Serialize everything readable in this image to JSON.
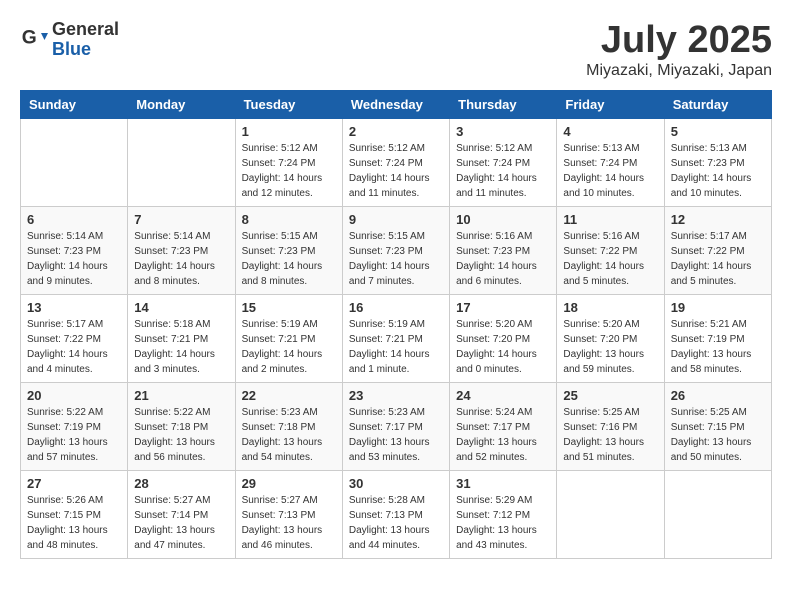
{
  "logo": {
    "general": "General",
    "blue": "Blue"
  },
  "header": {
    "month": "July 2025",
    "location": "Miyazaki, Miyazaki, Japan"
  },
  "weekdays": [
    "Sunday",
    "Monday",
    "Tuesday",
    "Wednesday",
    "Thursday",
    "Friday",
    "Saturday"
  ],
  "weeks": [
    [
      {
        "day": "",
        "info": ""
      },
      {
        "day": "",
        "info": ""
      },
      {
        "day": "1",
        "info": "Sunrise: 5:12 AM\nSunset: 7:24 PM\nDaylight: 14 hours and 12 minutes."
      },
      {
        "day": "2",
        "info": "Sunrise: 5:12 AM\nSunset: 7:24 PM\nDaylight: 14 hours and 11 minutes."
      },
      {
        "day": "3",
        "info": "Sunrise: 5:12 AM\nSunset: 7:24 PM\nDaylight: 14 hours and 11 minutes."
      },
      {
        "day": "4",
        "info": "Sunrise: 5:13 AM\nSunset: 7:24 PM\nDaylight: 14 hours and 10 minutes."
      },
      {
        "day": "5",
        "info": "Sunrise: 5:13 AM\nSunset: 7:23 PM\nDaylight: 14 hours and 10 minutes."
      }
    ],
    [
      {
        "day": "6",
        "info": "Sunrise: 5:14 AM\nSunset: 7:23 PM\nDaylight: 14 hours and 9 minutes."
      },
      {
        "day": "7",
        "info": "Sunrise: 5:14 AM\nSunset: 7:23 PM\nDaylight: 14 hours and 8 minutes."
      },
      {
        "day": "8",
        "info": "Sunrise: 5:15 AM\nSunset: 7:23 PM\nDaylight: 14 hours and 8 minutes."
      },
      {
        "day": "9",
        "info": "Sunrise: 5:15 AM\nSunset: 7:23 PM\nDaylight: 14 hours and 7 minutes."
      },
      {
        "day": "10",
        "info": "Sunrise: 5:16 AM\nSunset: 7:23 PM\nDaylight: 14 hours and 6 minutes."
      },
      {
        "day": "11",
        "info": "Sunrise: 5:16 AM\nSunset: 7:22 PM\nDaylight: 14 hours and 5 minutes."
      },
      {
        "day": "12",
        "info": "Sunrise: 5:17 AM\nSunset: 7:22 PM\nDaylight: 14 hours and 5 minutes."
      }
    ],
    [
      {
        "day": "13",
        "info": "Sunrise: 5:17 AM\nSunset: 7:22 PM\nDaylight: 14 hours and 4 minutes."
      },
      {
        "day": "14",
        "info": "Sunrise: 5:18 AM\nSunset: 7:21 PM\nDaylight: 14 hours and 3 minutes."
      },
      {
        "day": "15",
        "info": "Sunrise: 5:19 AM\nSunset: 7:21 PM\nDaylight: 14 hours and 2 minutes."
      },
      {
        "day": "16",
        "info": "Sunrise: 5:19 AM\nSunset: 7:21 PM\nDaylight: 14 hours and 1 minute."
      },
      {
        "day": "17",
        "info": "Sunrise: 5:20 AM\nSunset: 7:20 PM\nDaylight: 14 hours and 0 minutes."
      },
      {
        "day": "18",
        "info": "Sunrise: 5:20 AM\nSunset: 7:20 PM\nDaylight: 13 hours and 59 minutes."
      },
      {
        "day": "19",
        "info": "Sunrise: 5:21 AM\nSunset: 7:19 PM\nDaylight: 13 hours and 58 minutes."
      }
    ],
    [
      {
        "day": "20",
        "info": "Sunrise: 5:22 AM\nSunset: 7:19 PM\nDaylight: 13 hours and 57 minutes."
      },
      {
        "day": "21",
        "info": "Sunrise: 5:22 AM\nSunset: 7:18 PM\nDaylight: 13 hours and 56 minutes."
      },
      {
        "day": "22",
        "info": "Sunrise: 5:23 AM\nSunset: 7:18 PM\nDaylight: 13 hours and 54 minutes."
      },
      {
        "day": "23",
        "info": "Sunrise: 5:23 AM\nSunset: 7:17 PM\nDaylight: 13 hours and 53 minutes."
      },
      {
        "day": "24",
        "info": "Sunrise: 5:24 AM\nSunset: 7:17 PM\nDaylight: 13 hours and 52 minutes."
      },
      {
        "day": "25",
        "info": "Sunrise: 5:25 AM\nSunset: 7:16 PM\nDaylight: 13 hours and 51 minutes."
      },
      {
        "day": "26",
        "info": "Sunrise: 5:25 AM\nSunset: 7:15 PM\nDaylight: 13 hours and 50 minutes."
      }
    ],
    [
      {
        "day": "27",
        "info": "Sunrise: 5:26 AM\nSunset: 7:15 PM\nDaylight: 13 hours and 48 minutes."
      },
      {
        "day": "28",
        "info": "Sunrise: 5:27 AM\nSunset: 7:14 PM\nDaylight: 13 hours and 47 minutes."
      },
      {
        "day": "29",
        "info": "Sunrise: 5:27 AM\nSunset: 7:13 PM\nDaylight: 13 hours and 46 minutes."
      },
      {
        "day": "30",
        "info": "Sunrise: 5:28 AM\nSunset: 7:13 PM\nDaylight: 13 hours and 44 minutes."
      },
      {
        "day": "31",
        "info": "Sunrise: 5:29 AM\nSunset: 7:12 PM\nDaylight: 13 hours and 43 minutes."
      },
      {
        "day": "",
        "info": ""
      },
      {
        "day": "",
        "info": ""
      }
    ]
  ]
}
